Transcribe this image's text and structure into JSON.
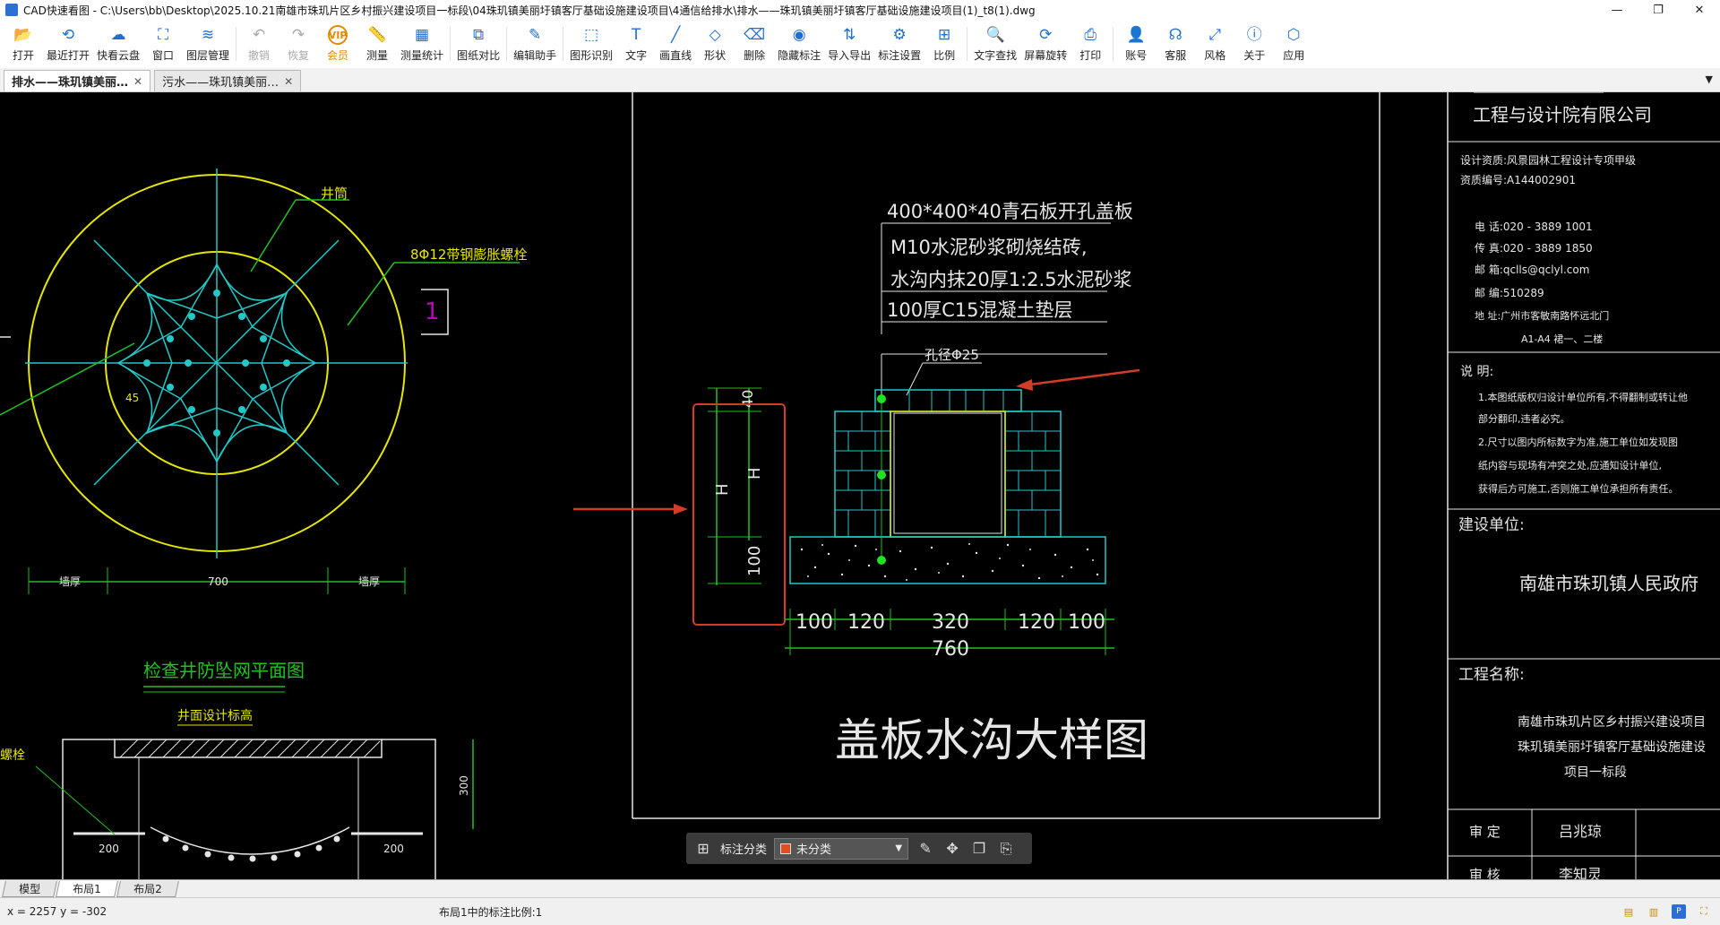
{
  "window": {
    "title": "CAD快速看图 - C:\\Users\\bb\\Desktop\\2025.10.21南雄市珠玑片区乡村振兴建设项目一标段\\04珠玑镇美丽圩镇客厅基础设施建设项目\\4通信给排水\\排水——珠玑镇美丽圩镇客厅基础设施建设项目(1)_t8(1).dwg",
    "minimize": "—",
    "maximize": "❐",
    "close": "✕"
  },
  "toolbar": [
    {
      "id": "open",
      "label": "打开",
      "icon": "folder-icon",
      "glyph": "📂"
    },
    {
      "id": "recent",
      "label": "最近打开",
      "icon": "clock-icon",
      "glyph": "⟲"
    },
    {
      "id": "cloud",
      "label": "快看云盘",
      "icon": "cloud-icon",
      "glyph": "☁"
    },
    {
      "id": "window",
      "label": "窗口",
      "icon": "window-icon",
      "glyph": "⛶"
    },
    {
      "id": "layers",
      "label": "图层管理",
      "icon": "layers-icon",
      "glyph": "≋"
    },
    {
      "id": "undo",
      "label": "撤销",
      "icon": "undo-icon",
      "glyph": "↶",
      "disabled": true
    },
    {
      "id": "redo",
      "label": "恢复",
      "icon": "redo-icon",
      "glyph": "↷",
      "disabled": true
    },
    {
      "id": "vip",
      "label": "会员",
      "icon": "vip-icon",
      "glyph": "VIP",
      "vip": true
    },
    {
      "id": "measure",
      "label": "测量",
      "icon": "ruler-icon",
      "glyph": "📏"
    },
    {
      "id": "measure-stats",
      "label": "测量统计",
      "icon": "stats-icon",
      "glyph": "▦"
    },
    {
      "id": "compare",
      "label": "图纸对比",
      "icon": "compare-icon",
      "glyph": "⧉"
    },
    {
      "id": "edit-helper",
      "label": "编辑助手",
      "icon": "edit-helper-icon",
      "glyph": "✎"
    },
    {
      "id": "shape-recog",
      "label": "图形识别",
      "icon": "shape-recog-icon",
      "glyph": "⬚"
    },
    {
      "id": "text",
      "label": "文字",
      "icon": "text-icon",
      "glyph": "T"
    },
    {
      "id": "line",
      "label": "画直线",
      "icon": "line-icon",
      "glyph": "╱"
    },
    {
      "id": "shape",
      "label": "形状",
      "icon": "shape-icon",
      "glyph": "◇"
    },
    {
      "id": "erase",
      "label": "删除",
      "icon": "eraser-icon",
      "glyph": "⌫"
    },
    {
      "id": "hide-anno",
      "label": "隐藏标注",
      "icon": "eye-hide-icon",
      "glyph": "◉"
    },
    {
      "id": "import-export",
      "label": "导入导出",
      "icon": "import-export-icon",
      "glyph": "⇅"
    },
    {
      "id": "anno-settings",
      "label": "标注设置",
      "icon": "anno-settings-icon",
      "glyph": "⚙"
    },
    {
      "id": "scale",
      "label": "比例",
      "icon": "scale-icon",
      "glyph": "⊞"
    },
    {
      "id": "text-search",
      "label": "文字查找",
      "icon": "text-search-icon",
      "glyph": "🔍"
    },
    {
      "id": "rotate",
      "label": "屏幕旋转",
      "icon": "rotate-icon",
      "glyph": "⟳"
    },
    {
      "id": "print",
      "label": "打印",
      "icon": "printer-icon",
      "glyph": "⎙"
    },
    {
      "id": "account",
      "label": "账号",
      "icon": "user-icon",
      "glyph": "👤"
    },
    {
      "id": "service",
      "label": "客服",
      "icon": "headset-icon",
      "glyph": "☊"
    },
    {
      "id": "style",
      "label": "风格",
      "icon": "style-icon",
      "glyph": "⤢"
    },
    {
      "id": "about",
      "label": "关于",
      "icon": "info-icon",
      "glyph": "ⓘ"
    },
    {
      "id": "apps",
      "label": "应用",
      "icon": "apps-icon",
      "glyph": "⬡"
    }
  ],
  "tabs": [
    {
      "label": "排水——珠玑镇美丽…",
      "active": true
    },
    {
      "label": "污水——珠玑镇美丽…",
      "active": false
    }
  ],
  "drawing": {
    "title": "盖板水沟大样图",
    "spec1": "400*400*40青石板开孔盖板",
    "spec2": "M10水泥砂浆砌烧结砖,",
    "spec3": "水沟内抹20厚1:2.5水泥砂浆",
    "spec4": "100厚C15混凝土垫层",
    "hole": "孔径Φ25",
    "dim_h1": "H",
    "dim_h2": "H",
    "dim_40": "40",
    "dim_100v": "100",
    "dims_bottom": [
      "100",
      "120",
      "320",
      "120",
      "100"
    ],
    "dim_total": "760",
    "left_label_well": "井筒",
    "left_label_bolt": "8Φ12带钢膨胀螺栓",
    "left_label_45": "45",
    "left_number": "1",
    "left_dims": [
      "墙厚",
      "700",
      "墙厚"
    ],
    "plan_title": "检查井防坠网平面图",
    "well_level": "井面设计标高",
    "bolt_partial": "螺栓",
    "dim_200a": "200",
    "dim_200b": "200",
    "dim_300": "300"
  },
  "titleblock": {
    "company": "工程与设计院有限公司",
    "cert1": "设计资质:风景园林工程设计专项甲级",
    "cert2": "资质编号:A144002901",
    "tel": "电  话:020 - 3889 1001",
    "fax": "传  真:020 - 3889 1850",
    "email": "邮  箱:qclls@qclyl.com",
    "zip": "邮  编:510289",
    "addr": "地  址:广州市客敏南路怀远北门",
    "addr2": "A1-A4 裙一、二楼",
    "notes_title": "说      明:",
    "note1": "1.本图纸版权归设计单位所有,不得翻制或转让他",
    "note1b": "  部分翻印,违者必究。",
    "note2": "2.尺寸以图内所标数字为准,施工单位如发现图",
    "note2b": "  纸内容与现场有冲突之处,应通知设计单位,",
    "note2c": "  获得后方可施工,否则施工单位承担所有责任。",
    "client_label": "建设单位:",
    "client": "南雄市珠玑镇人民政府",
    "project_label": "工程名称:",
    "project1": "南雄市珠玑片区乡村振兴建设项目",
    "project2": "珠玑镇美丽圩镇客厅基础设施建设",
    "project3": "项目一标段",
    "approve_label": "审      定",
    "approver": "吕兆琼",
    "review_label": "审      核",
    "reviewer": "李知灵"
  },
  "annobar": {
    "label": "标注分类",
    "value": "未分类",
    "swatch_color": "#e0501c"
  },
  "layout_tabs": [
    {
      "label": "模型",
      "active": false
    },
    {
      "label": "布局1",
      "active": true
    },
    {
      "label": "布局2",
      "active": false
    }
  ],
  "status": {
    "coords": "x = 2257  y = -302",
    "scale": "布局1中的标注比例:1"
  },
  "colors": {
    "cad_white": "#e6e6e6",
    "cad_cyan": "#23c8c8",
    "cad_yellow": "#e6e600",
    "cad_green": "#22c022",
    "cad_red": "#d23c28",
    "cad_magenta": "#c000c0"
  }
}
